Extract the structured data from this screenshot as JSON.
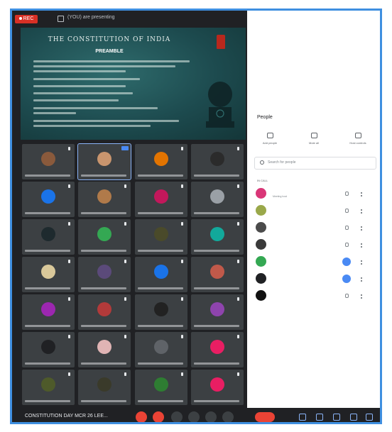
{
  "recording": {
    "label": "REC"
  },
  "topbar": {
    "presenting_text": "(YOU) are presenting"
  },
  "slide": {
    "title": "THE CONSTITUTION OF INDIA",
    "heading": "PREAMBLE"
  },
  "panel": {
    "title": "People",
    "actions": [
      {
        "label": "Add people",
        "icon": "add-person-icon"
      },
      {
        "label": "Mute all",
        "icon": "mute-all-icon"
      },
      {
        "label": "Host controls",
        "icon": "host-controls-icon"
      }
    ],
    "search": {
      "placeholder": "Search for people"
    },
    "in_call_label": "IN CALL",
    "participants": [
      {
        "name": "",
        "sub": "Meeting host",
        "color": "#d93677",
        "mic": "muted"
      },
      {
        "name": "",
        "sub": "",
        "color": "#9aa84a",
        "mic": "muted"
      },
      {
        "name": "",
        "sub": "",
        "color": "#4b4b4b",
        "mic": "muted"
      },
      {
        "name": "",
        "sub": "",
        "color": "#3a3a3a",
        "mic": "muted"
      },
      {
        "name": "",
        "sub": "",
        "color": "#34a853",
        "mic": "speaking"
      },
      {
        "name": "",
        "sub": "",
        "color": "#202124",
        "mic": "speaking"
      },
      {
        "name": "",
        "sub": "",
        "color": "#111111",
        "mic": "muted"
      }
    ]
  },
  "grid": {
    "tiles": [
      {
        "color": "#8a5a3c",
        "active": false,
        "badge": false
      },
      {
        "color": "#c9956e",
        "active": true,
        "badge": true
      },
      {
        "color": "#e37400",
        "active": false,
        "badge": false
      },
      {
        "color": "#2b2b2b",
        "active": false,
        "badge": false
      },
      {
        "color": "#1a73e8",
        "active": false,
        "badge": false
      },
      {
        "color": "#b07a4a",
        "active": false,
        "badge": false
      },
      {
        "color": "#c2185b",
        "active": false,
        "badge": false
      },
      {
        "color": "#9aa0a6",
        "active": false,
        "badge": false
      },
      {
        "color": "#1e2a2e",
        "active": false,
        "badge": false
      },
      {
        "color": "#34a853",
        "active": false,
        "badge": false
      },
      {
        "color": "#4a4a2a",
        "active": false,
        "badge": false
      },
      {
        "color": "#12a99b",
        "active": false,
        "badge": false
      },
      {
        "color": "#d9c89a",
        "active": false,
        "badge": false
      },
      {
        "color": "#5b4a7a",
        "active": false,
        "badge": false
      },
      {
        "color": "#1a73e8",
        "active": false,
        "badge": false
      },
      {
        "color": "#c0594a",
        "active": false,
        "badge": false
      },
      {
        "color": "#9c27b0",
        "active": false,
        "badge": false
      },
      {
        "color": "#b23a3a",
        "active": false,
        "badge": false
      },
      {
        "color": "#222222",
        "active": false,
        "badge": false
      },
      {
        "color": "#8e44ad",
        "active": false,
        "badge": false
      },
      {
        "color": "#202124",
        "active": false,
        "badge": false
      },
      {
        "color": "#e0b4b4",
        "active": false,
        "badge": false
      },
      {
        "color": "#5f6368",
        "active": false,
        "badge": false
      },
      {
        "color": "#e91e63",
        "active": false,
        "badge": false
      },
      {
        "color": "#4e5a2a",
        "active": false,
        "badge": false
      },
      {
        "color": "#3a3a2a",
        "active": false,
        "badge": false
      },
      {
        "color": "#2e7d32",
        "active": false,
        "badge": false
      },
      {
        "color": "#e91e63",
        "active": false,
        "badge": false
      }
    ]
  },
  "bottombar": {
    "meeting_title": "CONSTITUTION DAY MCR 26 LEE..."
  }
}
